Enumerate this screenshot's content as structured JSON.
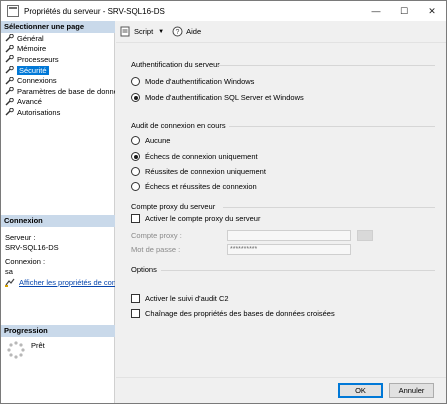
{
  "window": {
    "title": "Propriétés du serveur - SRV-SQL16-DS",
    "controls": {
      "minimize": "—",
      "maximize": "☐",
      "close": "✕"
    }
  },
  "left": {
    "select_page_header": "Sélectionner une page",
    "pages": [
      {
        "label": "Général",
        "selected": false
      },
      {
        "label": "Mémoire",
        "selected": false
      },
      {
        "label": "Processeurs",
        "selected": false
      },
      {
        "label": "Sécurité",
        "selected": true
      },
      {
        "label": "Connexions",
        "selected": false
      },
      {
        "label": "Paramètres de base de données",
        "selected": false
      },
      {
        "label": "Avancé",
        "selected": false
      },
      {
        "label": "Autorisations",
        "selected": false
      }
    ],
    "connection_header": "Connexion",
    "server_label": "Serveur :",
    "server_value": "SRV-SQL16-DS",
    "connection_label": "Connexion :",
    "connection_value": "sa",
    "view_connection_link": "Afficher les propriétés de connexion",
    "progress_header": "Progression",
    "progress_status": "Prêt"
  },
  "toolbar": {
    "script_label": "Script",
    "help_label": "Aide"
  },
  "auth": {
    "title": "Authentification du serveur",
    "windows_mode": "Mode d'authentification Windows",
    "mixed_mode": "Mode d'authentification SQL Server et Windows",
    "selected": "mixed"
  },
  "audit": {
    "title": "Audit de connexion en cours",
    "options": [
      "Aucune",
      "Échecs de connexion uniquement",
      "Réussites de connexion uniquement",
      "Échecs et réussites de connexion"
    ],
    "selected_index": 1
  },
  "proxy": {
    "title": "Compte proxy du serveur",
    "enable_label": "Activer le compte proxy du serveur",
    "account_label": "Compte proxy :",
    "account_value": "",
    "password_label": "Mot de passe :",
    "password_value": "**********"
  },
  "options": {
    "title": "Options",
    "c2_audit": "Activer le suivi d'audit C2",
    "cross_db_chaining": "Chaînage des propriétés des bases de données croisées"
  },
  "buttons": {
    "ok": "OK",
    "cancel": "Annuler"
  },
  "colors": {
    "section_header_bg": "#c9d9ea",
    "selected_item_bg": "#0078d7",
    "link": "#0645ad"
  }
}
